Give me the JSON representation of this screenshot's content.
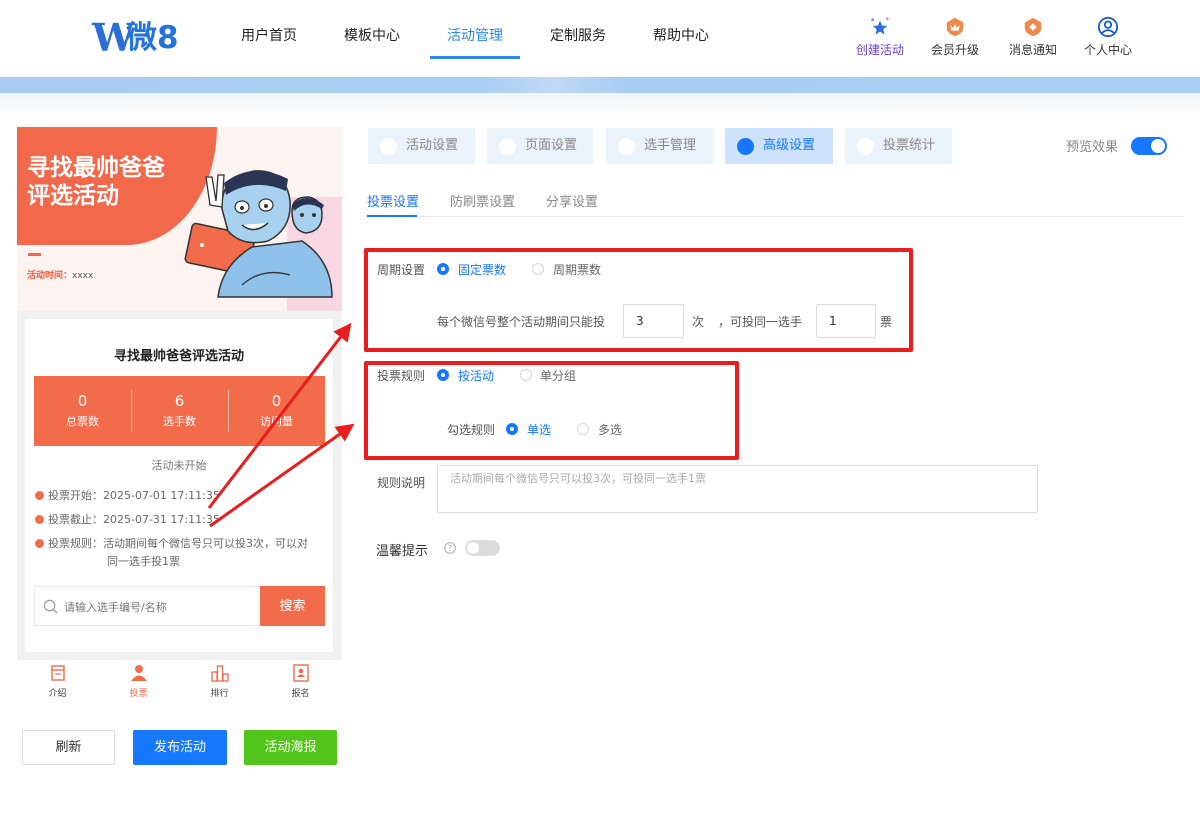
{
  "brand": {
    "logo_letter": "W",
    "logo_text": "微8"
  },
  "nav": {
    "items": [
      "用户首页",
      "模板中心",
      "活动管理",
      "定制服务",
      "帮助中心"
    ],
    "active_index": 2
  },
  "right_nav": {
    "create": "创建活动",
    "upgrade": "会员升级",
    "messages": "消息通知",
    "profile": "个人中心"
  },
  "preview": {
    "banner_title_line1": "寻找最帅爸爸",
    "banner_title_line2": "评选活动",
    "time_label": "活动时间：",
    "time_value": "xxxx",
    "card_title": "寻找最帅爸爸评选活动",
    "stats": [
      {
        "value": "0",
        "label": "总票数"
      },
      {
        "value": "6",
        "label": "选手数"
      },
      {
        "value": "0",
        "label": "访问量"
      }
    ],
    "status": "活动未开始",
    "vote_start": "投票开始：2025-07-01 17:11:35",
    "vote_end": "投票截止：2025-07-31 17:11:35",
    "vote_rule_line1": "投票规则：活动期间每个微信号只可以投3次，可以对",
    "vote_rule_line2": "同一选手投1票",
    "search_placeholder": "请输入选手编号/名称",
    "search_button": "搜索",
    "tabs": [
      "介绍",
      "投票",
      "排行",
      "报名"
    ],
    "active_tab": 1
  },
  "actions": {
    "refresh": "刷新",
    "publish": "发布活动",
    "poster": "活动海报"
  },
  "settings_tabs": [
    "活动设置",
    "页面设置",
    "选手管理",
    "高级设置",
    "投票统计"
  ],
  "settings_active": 3,
  "preview_effect": {
    "label": "预览效果",
    "on": true
  },
  "subtabs": [
    "投票设置",
    "防刷票设置",
    "分享设置"
  ],
  "form": {
    "period_label": "周期设置",
    "period_fixed": "固定票数",
    "period_cycle": "周期票数",
    "limit_text": "每个微信号整个活动期间只能投",
    "times_value": "3",
    "times_unit": "次",
    "same_player_text": "，可投同一选手",
    "votes_value": "1",
    "votes_unit": "票",
    "rule_label": "投票规则",
    "rule_by_activity": "按活动",
    "rule_by_group": "单分组",
    "select_label": "勾选规则",
    "select_single": "单选",
    "select_multi": "多选",
    "desc_label": "规则说明",
    "desc_placeholder": "活动期间每个微信号只可以投3次，可投同一选手1票",
    "tips_label": "温馨提示",
    "tips_on": false
  },
  "colors": {
    "primary": "#1677ff",
    "accent": "#f26b4b",
    "highlight": "#ea1c1c",
    "green": "#52c41a"
  }
}
